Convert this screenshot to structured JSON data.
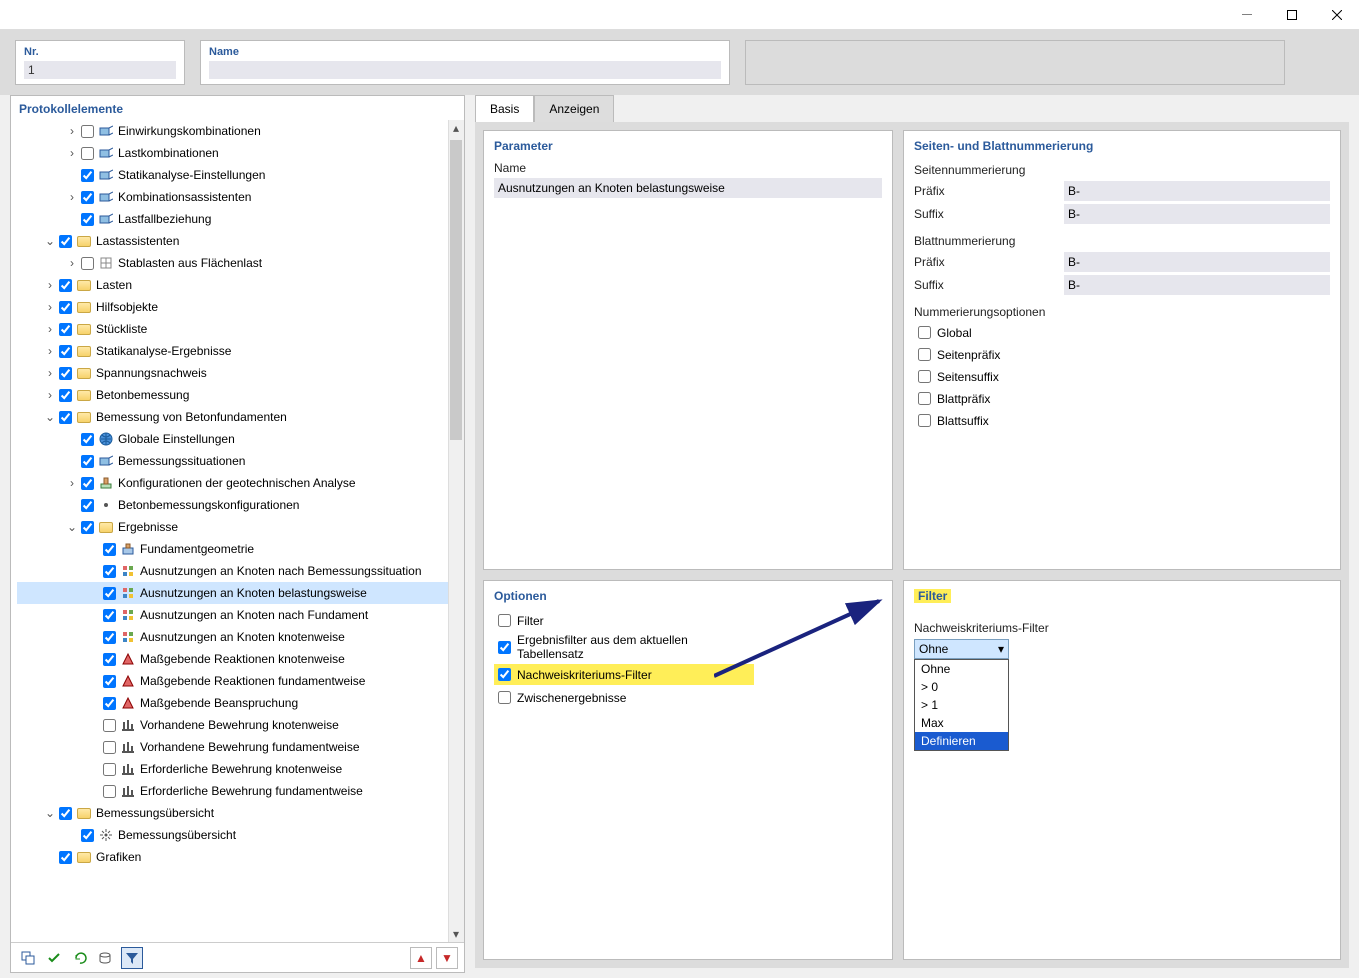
{
  "titlebar": {
    "minimize": "—",
    "maximize": "☐",
    "close": "✕"
  },
  "top": {
    "nr_label": "Nr.",
    "nr_val": "1",
    "name_label": "Name",
    "name_val": ""
  },
  "left_title": "Protokollelemente",
  "tree": [
    {
      "d": 2,
      "tw": "›",
      "cb": false,
      "icon": "misc",
      "t": "Einwirkungskombinationen"
    },
    {
      "d": 2,
      "tw": "›",
      "cb": false,
      "icon": "misc",
      "t": "Lastkombinationen"
    },
    {
      "d": 2,
      "tw": " ",
      "cb": true,
      "icon": "misc",
      "t": "Statikanalyse-Einstellungen"
    },
    {
      "d": 2,
      "tw": "›",
      "cb": true,
      "icon": "misc",
      "t": "Kombinationsassistenten"
    },
    {
      "d": 2,
      "tw": " ",
      "cb": true,
      "icon": "misc",
      "t": "Lastfallbeziehung"
    },
    {
      "d": 1,
      "tw": "v",
      "cb": true,
      "icon": "folder",
      "t": "Lastassistenten"
    },
    {
      "d": 2,
      "tw": "›",
      "cb": false,
      "icon": "misc2",
      "t": "Stablasten aus Flächenlast"
    },
    {
      "d": 1,
      "tw": "›",
      "cb": true,
      "icon": "folder",
      "t": "Lasten"
    },
    {
      "d": 1,
      "tw": "›",
      "cb": true,
      "icon": "folder",
      "t": "Hilfsobjekte"
    },
    {
      "d": 1,
      "tw": "›",
      "cb": true,
      "icon": "folder",
      "t": "Stückliste"
    },
    {
      "d": 1,
      "tw": "›",
      "cb": true,
      "icon": "folder",
      "t": "Statikanalyse-Ergebnisse"
    },
    {
      "d": 1,
      "tw": "›",
      "cb": true,
      "icon": "folder",
      "t": "Spannungsnachweis"
    },
    {
      "d": 1,
      "tw": "›",
      "cb": true,
      "icon": "folder",
      "t": "Betonbemessung"
    },
    {
      "d": 1,
      "tw": "v",
      "cb": true,
      "icon": "folder",
      "t": "Bemessung von Betonfundamenten"
    },
    {
      "d": 2,
      "tw": " ",
      "cb": true,
      "icon": "globe",
      "t": "Globale Einstellungen"
    },
    {
      "d": 2,
      "tw": " ",
      "cb": true,
      "icon": "misc",
      "t": "Bemessungssituationen"
    },
    {
      "d": 2,
      "tw": "›",
      "cb": true,
      "icon": "geo",
      "t": "Konfigurationen der geotechnischen Analyse"
    },
    {
      "d": 2,
      "tw": " ",
      "cb": true,
      "icon": "dot",
      "t": "Betonbemessungskonfigurationen"
    },
    {
      "d": 2,
      "tw": "v",
      "cb": true,
      "icon": "folder",
      "t": "Ergebnisse"
    },
    {
      "d": 3,
      "tw": " ",
      "cb": true,
      "icon": "res",
      "t": "Fundamentgeometrie"
    },
    {
      "d": 3,
      "tw": " ",
      "cb": true,
      "icon": "res2",
      "t": "Ausnutzungen an Knoten nach Bemessungssituation"
    },
    {
      "d": 3,
      "tw": " ",
      "cb": true,
      "icon": "res2",
      "t": "Ausnutzungen an Knoten belastungsweise",
      "sel": true
    },
    {
      "d": 3,
      "tw": " ",
      "cb": true,
      "icon": "res2",
      "t": "Ausnutzungen an Knoten nach Fundament"
    },
    {
      "d": 3,
      "tw": " ",
      "cb": true,
      "icon": "res2",
      "t": "Ausnutzungen an Knoten knotenweise"
    },
    {
      "d": 3,
      "tw": " ",
      "cb": true,
      "icon": "res3",
      "t": "Maßgebende Reaktionen knotenweise"
    },
    {
      "d": 3,
      "tw": " ",
      "cb": true,
      "icon": "res3",
      "t": "Maßgebende Reaktionen fundamentweise"
    },
    {
      "d": 3,
      "tw": " ",
      "cb": true,
      "icon": "res3",
      "t": "Maßgebende Beanspruchung"
    },
    {
      "d": 3,
      "tw": " ",
      "cb": false,
      "icon": "rebar",
      "t": "Vorhandene Bewehrung knotenweise"
    },
    {
      "d": 3,
      "tw": " ",
      "cb": false,
      "icon": "rebar",
      "t": "Vorhandene Bewehrung fundamentweise"
    },
    {
      "d": 3,
      "tw": " ",
      "cb": false,
      "icon": "rebar",
      "t": "Erforderliche Bewehrung knotenweise"
    },
    {
      "d": 3,
      "tw": " ",
      "cb": false,
      "icon": "rebar",
      "t": "Erforderliche Bewehrung fundamentweise"
    },
    {
      "d": 1,
      "tw": "v",
      "cb": true,
      "icon": "folder",
      "t": "Bemessungsübersicht"
    },
    {
      "d": 2,
      "tw": " ",
      "cb": true,
      "icon": "spark",
      "t": "Bemessungsübersicht"
    },
    {
      "d": 1,
      "tw": " ",
      "cb": true,
      "icon": "folder",
      "t": "Grafiken"
    }
  ],
  "tabs": {
    "basis": "Basis",
    "anzeigen": "Anzeigen"
  },
  "param": {
    "title": "Parameter",
    "name_label": "Name",
    "name_val": "Ausnutzungen an Knoten belastungsweise"
  },
  "numbering": {
    "title": "Seiten- und Blattnummerierung",
    "page_title": "Seitennummerierung",
    "prefix": "Präfix",
    "suffix": "Suffix",
    "pval": "B-",
    "sval": "B-",
    "sheet_title": "Blattnummerierung",
    "sp": "B-",
    "ss": "B-",
    "opt_title": "Nummerierungsoptionen",
    "opts": [
      "Global",
      "Seitenpräfix",
      "Seitensuffix",
      "Blattpräfix",
      "Blattsuffix"
    ]
  },
  "options": {
    "title": "Optionen",
    "items": [
      {
        "t": "Filter",
        "c": false
      },
      {
        "t": "Ergebnisfilter aus dem aktuellen Tabellensatz",
        "c": true
      },
      {
        "t": "Nachweiskriteriums-Filter",
        "c": true,
        "hl": true
      },
      {
        "t": "Zwischenergebnisse",
        "c": false
      }
    ]
  },
  "filter": {
    "title": "Filter",
    "label": "Nachweiskriteriums-Filter",
    "selected": "Ohne",
    "opts": [
      "Ohne",
      "> 0",
      "> 1",
      "Max",
      "Definieren"
    ],
    "hl_index": 4
  }
}
